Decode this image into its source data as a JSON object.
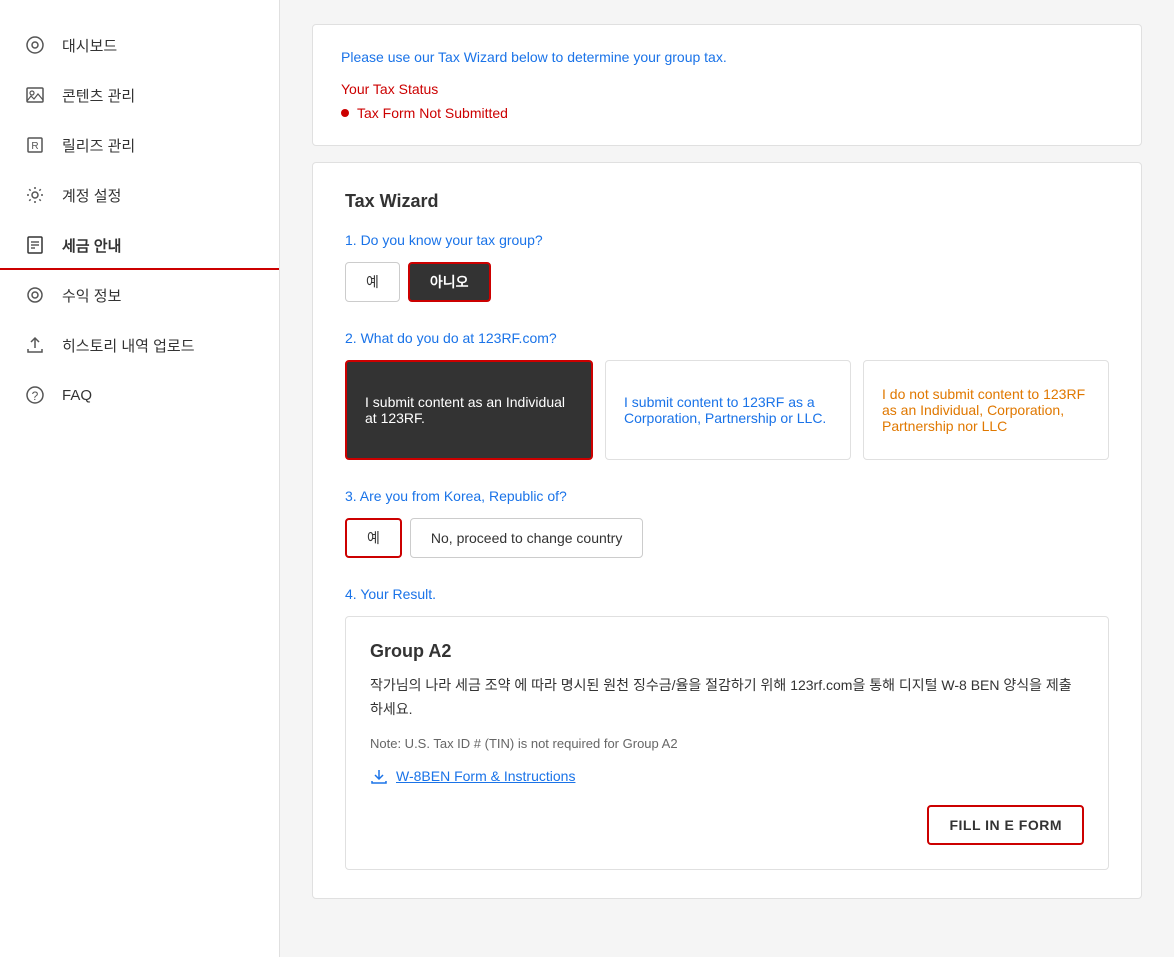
{
  "sidebar": {
    "items": [
      {
        "id": "dashboard",
        "label": "대시보드",
        "icon": "⊙"
      },
      {
        "id": "content",
        "label": "콘텐츠 관리",
        "icon": "🖼"
      },
      {
        "id": "release",
        "label": "릴리즈 관리",
        "icon": "®"
      },
      {
        "id": "settings",
        "label": "계정 설정",
        "icon": "⚙"
      },
      {
        "id": "tax",
        "label": "세금 안내",
        "icon": "📋",
        "active": true
      },
      {
        "id": "revenue",
        "label": "수익 정보",
        "icon": "◎"
      },
      {
        "id": "history",
        "label": "히스토리 내역 업로드",
        "icon": "⬆"
      },
      {
        "id": "faq",
        "label": "FAQ",
        "icon": "?"
      }
    ]
  },
  "tax_status_section": {
    "intro": "Please use our Tax Wizard below to determine your group tax.",
    "your_tax_status_label": "Your Tax Status",
    "status_item": "Tax Form Not Submitted"
  },
  "wizard": {
    "title": "Tax Wizard",
    "q1": {
      "question": "1. Do you know your tax group?",
      "options": [
        {
          "id": "yes",
          "label": "예"
        },
        {
          "id": "no",
          "label": "아니오",
          "selected": true
        }
      ]
    },
    "q2": {
      "question": "2. What do you do at 123RF.com?",
      "options": [
        {
          "id": "individual",
          "label": "I submit content as an Individual at 123RF.",
          "selected": true
        },
        {
          "id": "corporation",
          "label": "I submit content to 123RF as a Corporation, Partnership or LLC."
        },
        {
          "id": "neither",
          "label": "I do not submit content to 123RF as an Individual, Corporation, Partnership nor LLC"
        }
      ]
    },
    "q3": {
      "question": "3. Are you from Korea, Republic of?",
      "options": [
        {
          "id": "yes",
          "label": "예",
          "selected": true
        },
        {
          "id": "no",
          "label": "No, proceed to change country"
        }
      ]
    },
    "q4": {
      "question": "4. Your Result.",
      "result": {
        "group": "Group A2",
        "description": "작가님의 나라 세금 조약 에 따라 명시된 원천 징수금/율을 절감하기 위해 123rf.com을 통해 디지털 W-8 BEN 양식을 제출하세요.",
        "note": "Note: U.S. Tax ID # (TIN) is not required for Group A2",
        "download_label": "W-8BEN Form & Instructions",
        "fill_button": "FILL IN E FORM"
      }
    }
  }
}
